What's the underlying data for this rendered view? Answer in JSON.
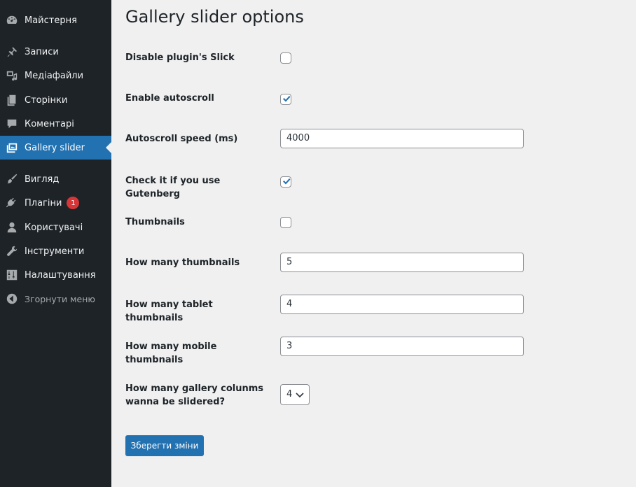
{
  "sidebar": {
    "items": [
      {
        "label": "Майстерня",
        "icon": "dashboard-icon"
      },
      {
        "label": "Записи",
        "icon": "pushpin-icon"
      },
      {
        "label": "Медіафайли",
        "icon": "media-icon"
      },
      {
        "label": "Сторінки",
        "icon": "pages-icon"
      },
      {
        "label": "Коментарі",
        "icon": "comment-icon"
      },
      {
        "label": "Gallery slider",
        "icon": "gallery-icon",
        "active": true
      },
      {
        "label": "Вигляд",
        "icon": "appearance-brush-icon"
      },
      {
        "label": "Плагіни",
        "icon": "plugin-icon",
        "badge": "1"
      },
      {
        "label": "Користувачі",
        "icon": "user-icon"
      },
      {
        "label": "Інструменти",
        "icon": "wrench-icon"
      },
      {
        "label": "Налаштування",
        "icon": "settings-sliders-icon"
      },
      {
        "label": "Згорнути меню",
        "icon": "collapse-arrow-icon"
      }
    ]
  },
  "page": {
    "title": "Gallery slider options"
  },
  "form": {
    "disable_slick": {
      "label": "Disable plugin's Slick",
      "checked": false
    },
    "enable_autoscroll": {
      "label": "Enable autoscroll",
      "checked": true
    },
    "autoscroll_speed": {
      "label": "Autoscroll speed (ms)",
      "value": "4000"
    },
    "gutenberg": {
      "label": "Check it if you use Gutenberg",
      "checked": true
    },
    "thumbnails": {
      "label": "Thumbnails",
      "checked": false
    },
    "thumbs_count": {
      "label": "How many thumbnails",
      "value": "5"
    },
    "tablet_thumbs": {
      "label": "How many tablet thumbnails",
      "value": "4"
    },
    "mobile_thumbs": {
      "label": "How many mobile thumbnails",
      "value": "3"
    },
    "gallery_columns": {
      "label_line1": "How many gallery colunms",
      "label_line2": "wanna be slidered?",
      "selected": "4"
    },
    "submit_label": "Зберегти зміни"
  },
  "colors": {
    "sidebar_bg": "#1d2327",
    "accent": "#2271b1",
    "badge": "#d63638",
    "content_bg": "#f0f0f1"
  }
}
